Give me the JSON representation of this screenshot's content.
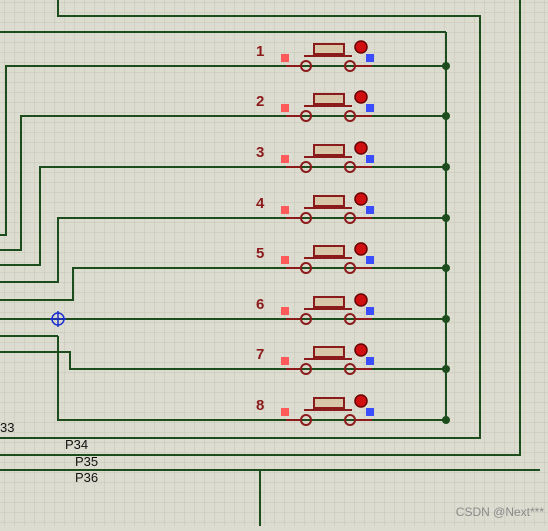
{
  "schematic": {
    "buttons": [
      {
        "label": "1"
      },
      {
        "label": "2"
      },
      {
        "label": "3"
      },
      {
        "label": "4"
      },
      {
        "label": "5"
      },
      {
        "label": "6"
      },
      {
        "label": "7"
      },
      {
        "label": "8"
      }
    ],
    "net_labels": {
      "p33": "33",
      "p34": "P34",
      "p35": "P35",
      "p36": "P36"
    },
    "watermark": "CSDN @Next***"
  },
  "colors": {
    "background": "#dcdcd0",
    "grid": "#c4c4b6",
    "wire": "#1d4d1d",
    "component": "#8b1a1a",
    "button_fill": "#d8c7a8",
    "pin_red": "#ff5a5a",
    "pin_blue": "#3a4dff",
    "probe": "#1a2fd0"
  }
}
